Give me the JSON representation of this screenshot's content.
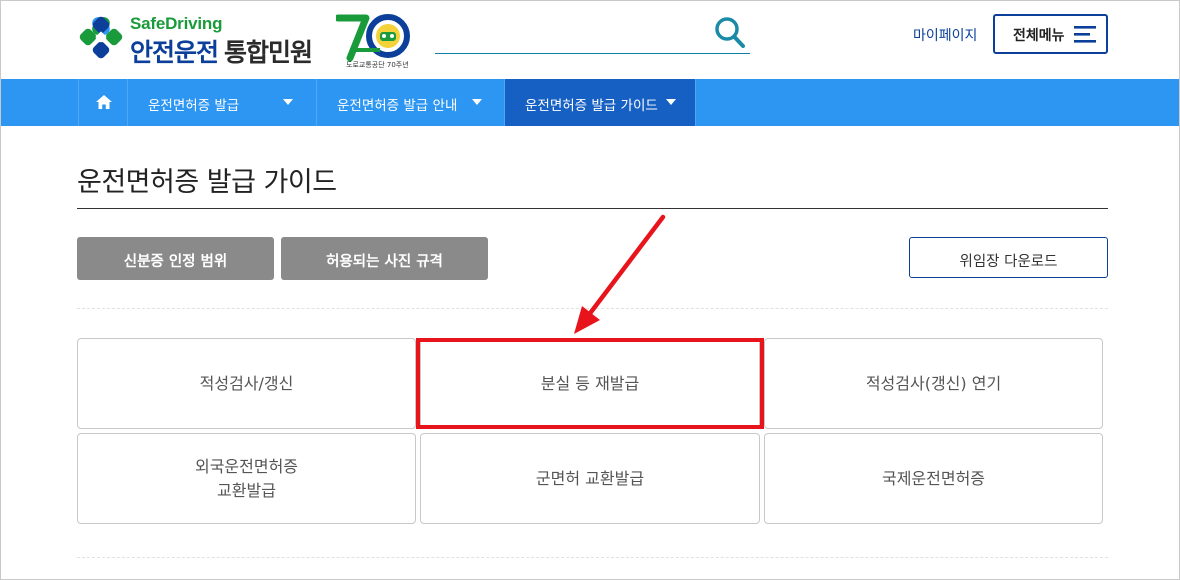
{
  "header": {
    "logo_en": "SafeDriving",
    "logo_ko_main": "안전운전",
    "logo_ko_sub": "통합민원",
    "logo_70_caption": "도로교통공단 70주년",
    "search_placeholder": "",
    "mypage_label": "마이페이지",
    "allmenu_label": "전체메뉴"
  },
  "nav": {
    "home_icon": "home-icon",
    "items": [
      {
        "label": "운전면허증 발급"
      },
      {
        "label": "운전면허증 발급 안내"
      },
      {
        "label": "운전면허증 발급 가이드"
      }
    ]
  },
  "content": {
    "page_title": "운전면허증 발급 가이드",
    "btn_id_scope": "신분증 인정 범위",
    "btn_photo_spec": "허용되는 사진 규격",
    "btn_proxy_download": "위임장 다운로드",
    "cards": [
      {
        "label": "적성검사/갱신"
      },
      {
        "label": "분실 등 재발급"
      },
      {
        "label": "적성검사(갱신) 연기"
      },
      {
        "label": "외국운전면허증\n교환발급"
      },
      {
        "label": "군면허 교환발급"
      },
      {
        "label": "국제운전면허증"
      }
    ]
  },
  "colors": {
    "nav_bg": "#2d96f2",
    "nav_active": "#1660c4",
    "brand_blue": "#0b3f9a",
    "brand_green": "#1a9b3b",
    "highlight_red": "#e8141c"
  }
}
